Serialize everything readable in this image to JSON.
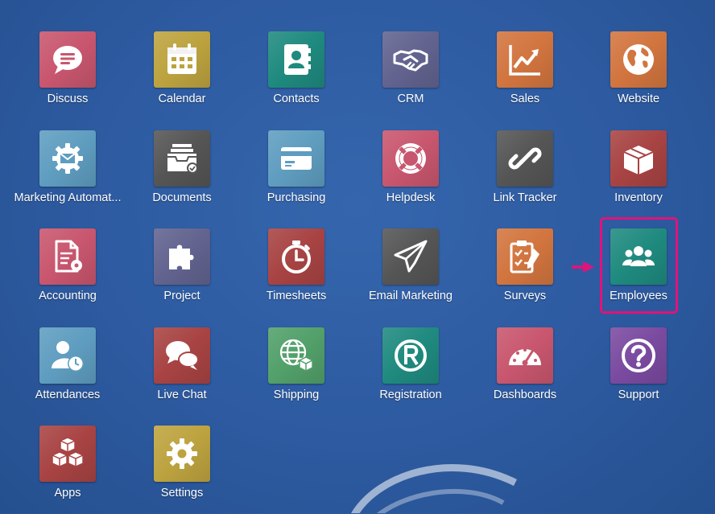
{
  "apps": [
    {
      "label": "Discuss",
      "icon": "chat-bubble-icon",
      "color": "#c8566e"
    },
    {
      "label": "Calendar",
      "icon": "calendar-icon",
      "color": "#bda33f"
    },
    {
      "label": "Contacts",
      "icon": "address-book-icon",
      "color": "#1f8a7f"
    },
    {
      "label": "CRM",
      "icon": "handshake-icon",
      "color": "#62638f"
    },
    {
      "label": "Sales",
      "icon": "trending-chart-icon",
      "color": "#d2753f"
    },
    {
      "label": "Website",
      "icon": "globe-icon",
      "color": "#d2753f"
    },
    {
      "label": "Marketing Automat...",
      "icon": "gear-envelope-icon",
      "color": "#5f9dc0"
    },
    {
      "label": "Documents",
      "icon": "inbox-tray-icon",
      "color": "#555555"
    },
    {
      "label": "Purchasing",
      "icon": "credit-card-icon",
      "color": "#5f9dc0"
    },
    {
      "label": "Helpdesk",
      "icon": "lifebuoy-icon",
      "color": "#c8566e"
    },
    {
      "label": "Link Tracker",
      "icon": "link-icon",
      "color": "#555555"
    },
    {
      "label": "Inventory",
      "icon": "box-icon",
      "color": "#a84343"
    },
    {
      "label": "Accounting",
      "icon": "document-gear-icon",
      "color": "#c8566e"
    },
    {
      "label": "Project",
      "icon": "puzzle-icon",
      "color": "#62638f"
    },
    {
      "label": "Timesheets",
      "icon": "stopwatch-icon",
      "color": "#a84343"
    },
    {
      "label": "Email Marketing",
      "icon": "paper-plane-icon",
      "color": "#555555"
    },
    {
      "label": "Surveys",
      "icon": "checklist-icon",
      "color": "#d2753f"
    },
    {
      "label": "Employees",
      "icon": "users-icon",
      "color": "#1f8a7f"
    },
    {
      "label": "Attendances",
      "icon": "user-clock-icon",
      "color": "#5f9dc0"
    },
    {
      "label": "Live Chat",
      "icon": "chat-bubbles-icon",
      "color": "#a84343"
    },
    {
      "label": "Shipping",
      "icon": "globe-package-icon",
      "color": "#52a06a"
    },
    {
      "label": "Registration",
      "icon": "registered-icon",
      "color": "#1f8a7f"
    },
    {
      "label": "Dashboards",
      "icon": "gauge-icon",
      "color": "#c8566e"
    },
    {
      "label": "Support",
      "icon": "question-icon",
      "color": "#7a4aa0"
    },
    {
      "label": "Apps",
      "icon": "cubes-icon",
      "color": "#a84343"
    },
    {
      "label": "Settings",
      "icon": "gear-icon",
      "color": "#bda33f"
    }
  ],
  "highlight": {
    "target": "Employees",
    "color": "#e0137b"
  }
}
